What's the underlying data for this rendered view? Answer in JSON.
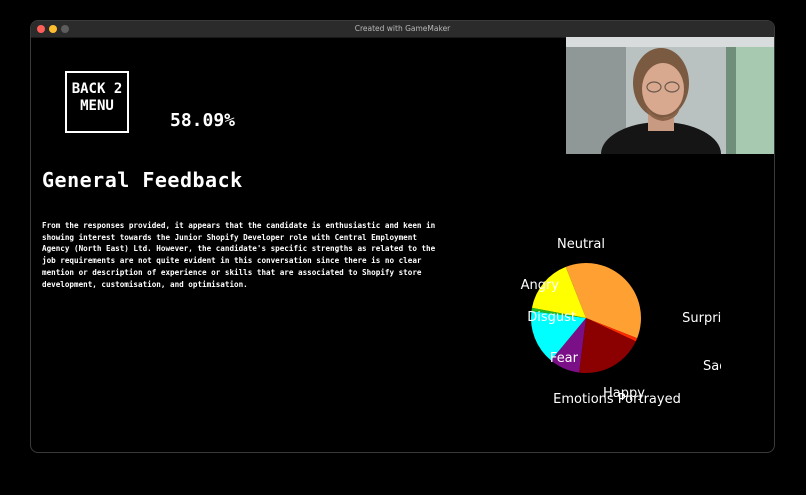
{
  "window": {
    "title": "Created with GameMaker"
  },
  "back_button": {
    "label": "BACK 2\nMENU"
  },
  "score": "58.09%",
  "section_title": "General Feedback",
  "feedback_text": "From the responses provided, it appears that the candidate is enthusiastic and keen in showing interest towards the Junior Shopify Developer role with Central Employment Agency (North East) Ltd. However, the candidate's specific strengths as related to the job requirements are not quite evident in this conversation since there is no clear mention or description of experience or skills that are associated to Shopify store development, customisation, and optimisation.",
  "chart_data": {
    "type": "pie",
    "title": "Emotions Portrayed",
    "categories": [
      "Neutral",
      "Surprise",
      "Sad",
      "Happy",
      "Fear",
      "Disgust",
      "Angry"
    ],
    "values": [
      37,
      1,
      20,
      9,
      16,
      1,
      16
    ],
    "colors": [
      "#ffa033",
      "#ff2a00",
      "#8b0000",
      "#7a0f87",
      "#00ffff",
      "#22bb22",
      "#ffff00"
    ]
  },
  "colors": {
    "background": "#000000",
    "titlebar": "#2b2b2b",
    "text": "#ffffff"
  }
}
